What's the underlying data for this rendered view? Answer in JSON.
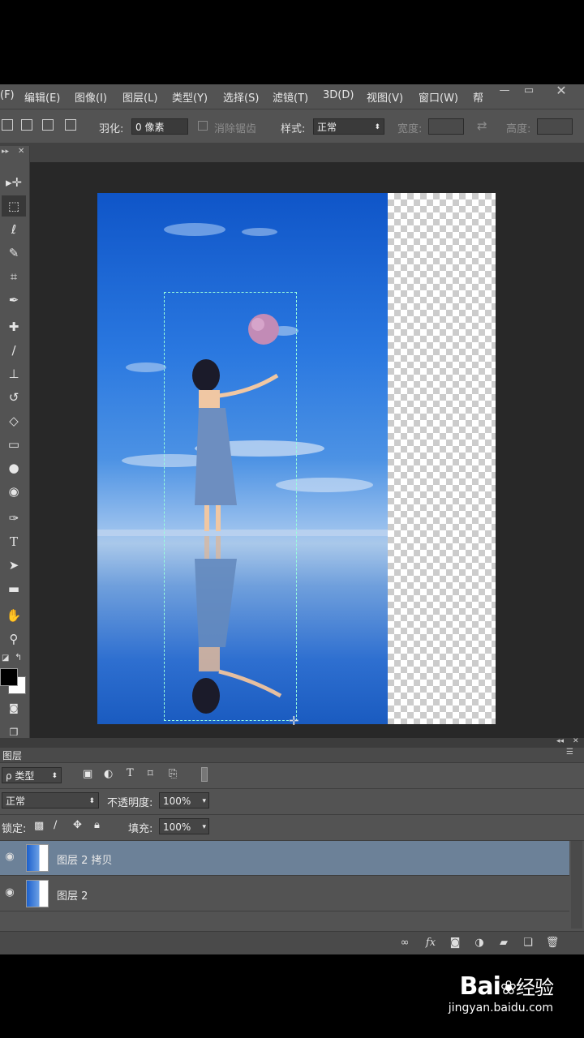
{
  "menu": [
    "(F)",
    "编辑(E)",
    "图像(I)",
    "图层(L)",
    "类型(Y)",
    "选择(S)",
    "滤镜(T)",
    "3D(D)",
    "视图(V)",
    "窗口(W)",
    "帮"
  ],
  "options": {
    "feather_label": "羽化:",
    "feather_value": "0 像素",
    "antialias_label": "消除锯齿",
    "style_label": "样式:",
    "style_value": "正常",
    "width_label": "宽度:",
    "height_label": "高度:"
  },
  "layers_panel": {
    "title": "图层",
    "filter_value": "ρ 类型",
    "blend_mode": "正常",
    "opacity_label": "不透明度:",
    "opacity_value": "100%",
    "lock_label": "锁定:",
    "fill_label": "填充:",
    "fill_value": "100%",
    "layers": [
      {
        "name": "图层 2 拷贝",
        "selected": true
      },
      {
        "name": "图层 2",
        "selected": false
      }
    ]
  },
  "watermark": {
    "brand": "Bai",
    "brand2": "经验",
    "url": "jingyan.baidu.com"
  },
  "colors": {
    "ui_panel": "#535353",
    "workspace": "#282828",
    "selected_layer": "#6c8198"
  }
}
